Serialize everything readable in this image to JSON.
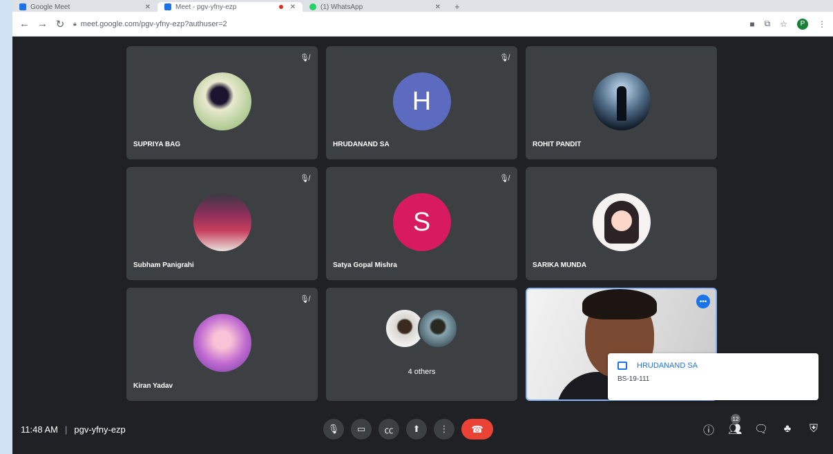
{
  "browser": {
    "tabs": [
      {
        "title": "Google Meet"
      },
      {
        "title": "Meet - pgv-yfny-ezp"
      },
      {
        "title": "(1) WhatsApp"
      }
    ],
    "url": "meet.google.com/pgv-yfny-ezp?authuser=2",
    "profile_initial": "P"
  },
  "tiles": [
    {
      "name": "SUPRIYA BAG",
      "muted": true
    },
    {
      "name": "HRUDANAND SA",
      "letter": "H",
      "color": "#5c6bc0",
      "muted": true
    },
    {
      "name": "ROHIT PANDIT",
      "muted": false
    },
    {
      "name": "Subham Panigrahi",
      "muted": true
    },
    {
      "name": "Satya Gopal Mishra",
      "letter": "S",
      "color": "#d81b60",
      "muted": true
    },
    {
      "name": "SARIKA MUNDA",
      "muted": false
    },
    {
      "name": "Kiran Yadav",
      "muted": true
    },
    {
      "others_label": "4 others"
    }
  ],
  "toast": {
    "sender": "HRUDANAND SA",
    "message": "BS-19-111"
  },
  "bottom": {
    "time": "11:48 AM",
    "meeting_code": "pgv-yfny-ezp",
    "participants_count": "12"
  },
  "colors": {
    "background": "#202124",
    "tile": "#3c4043",
    "end_call": "#ea4335",
    "accent": "#1a73e8"
  }
}
